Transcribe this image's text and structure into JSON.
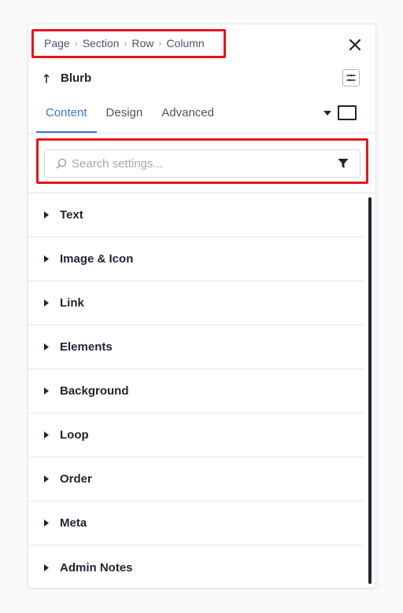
{
  "breadcrumb": {
    "items": [
      "Page",
      "Section",
      "Row",
      "Column"
    ],
    "separator": "›"
  },
  "module": {
    "title": "Blurb"
  },
  "tabs": [
    {
      "label": "Content",
      "active": true
    },
    {
      "label": "Design",
      "active": false
    },
    {
      "label": "Advanced",
      "active": false
    }
  ],
  "search": {
    "placeholder": "Search settings...",
    "value": ""
  },
  "groups": [
    {
      "label": "Text"
    },
    {
      "label": "Image & Icon"
    },
    {
      "label": "Link"
    },
    {
      "label": "Elements"
    },
    {
      "label": "Background"
    },
    {
      "label": "Loop"
    },
    {
      "label": "Order"
    },
    {
      "label": "Meta"
    },
    {
      "label": "Admin Notes"
    }
  ],
  "icons": {
    "close": "close-icon",
    "back": "undo-arrow-icon",
    "preset": "preset-settings-icon",
    "device": "desktop-view-icon",
    "search": "search-icon",
    "filter": "filter-icon",
    "expand": "caret-right-icon"
  },
  "colors": {
    "accent": "#3b73d8",
    "highlight": "#e8141c",
    "text": "#1e2430",
    "muted": "#4a5568"
  }
}
